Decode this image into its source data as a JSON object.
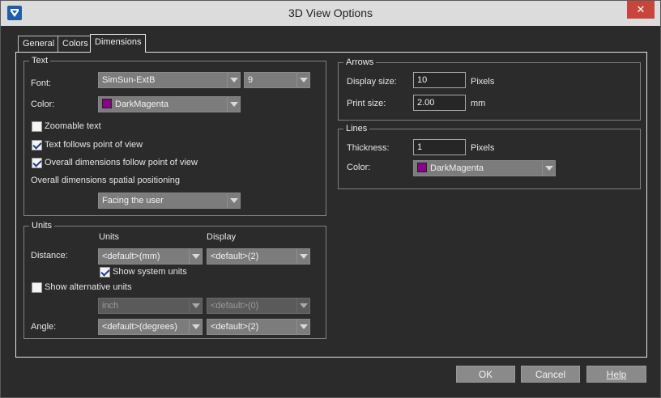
{
  "window": {
    "title": "3D View Options"
  },
  "tabs": [
    {
      "label": "General",
      "active": false
    },
    {
      "label": "Colors",
      "active": false
    },
    {
      "label": "Dimensions",
      "active": true
    }
  ],
  "text_group": {
    "legend": "Text",
    "font_label": "Font:",
    "font_value": "SimSun-ExtB",
    "font_size_value": "9",
    "color_label": "Color:",
    "color_value": "DarkMagenta",
    "color_hex": "#8b008b",
    "zoomable_label": "Zoomable text",
    "zoomable_checked": false,
    "follows_label": "Text follows point of view",
    "follows_checked": true,
    "overall_follow_label": "Overall dimensions follow point of view",
    "overall_follow_checked": true,
    "spatial_label": "Overall dimensions spatial positioning",
    "spatial_value": "Facing the user"
  },
  "units_group": {
    "legend": "Units",
    "col_units": "Units",
    "col_display": "Display",
    "distance_label": "Distance:",
    "distance_units": "<default>(mm)",
    "distance_display": "<default>(2)",
    "show_system_label": "Show system units",
    "show_system_checked": true,
    "show_alt_label": "Show alternative units",
    "show_alt_checked": false,
    "alt_units": "inch",
    "alt_display": "<default>(0)",
    "angle_label": "Angle:",
    "angle_units": "<default>(degrees)",
    "angle_display": "<default>(2)"
  },
  "arrows_group": {
    "legend": "Arrows",
    "display_size_label": "Display size:",
    "display_size_value": "10",
    "display_size_unit": "Pixels",
    "print_size_label": "Print size:",
    "print_size_value": "2.00",
    "print_size_unit": "mm"
  },
  "lines_group": {
    "legend": "Lines",
    "thickness_label": "Thickness:",
    "thickness_value": "1",
    "thickness_unit": "Pixels",
    "color_label": "Color:",
    "color_value": "DarkMagenta"
  },
  "buttons": {
    "ok": "OK",
    "cancel": "Cancel",
    "help": "Help"
  }
}
